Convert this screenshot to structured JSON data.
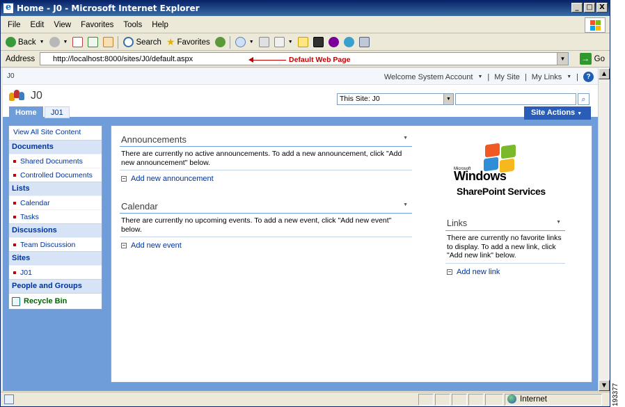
{
  "window": {
    "title": "Home - J0 - Microsoft Internet Explorer",
    "controls": [
      "_",
      "□",
      "X"
    ]
  },
  "menu": [
    "File",
    "Edit",
    "View",
    "Favorites",
    "Tools",
    "Help"
  ],
  "toolbar": {
    "back": "Back",
    "search": "Search",
    "favorites": "Favorites"
  },
  "address": {
    "label": "Address",
    "url": "http://localhost:8000/sites/J0/default.aspx",
    "go": "Go",
    "annotation": "Default Web Page"
  },
  "sharepoint": {
    "breadcrumb": "J0",
    "welcome": "Welcome System Account",
    "my_site": "My Site",
    "my_links": "My Links",
    "site_name": "J0",
    "search_scope": "This Site: J0",
    "tabs": [
      "Home",
      "J01"
    ],
    "site_actions": "Site Actions"
  },
  "leftnav": {
    "view_all": "View All Site Content",
    "sections": [
      {
        "heading": "Documents",
        "items": [
          "Shared Documents",
          "Controlled Documents"
        ]
      },
      {
        "heading": "Lists",
        "items": [
          "Calendar",
          "Tasks"
        ]
      },
      {
        "heading": "Discussions",
        "items": [
          "Team Discussion"
        ]
      },
      {
        "heading": "Sites",
        "items": [
          "J01"
        ]
      },
      {
        "heading": "People and Groups",
        "items": []
      }
    ],
    "recycle_bin": "Recycle Bin"
  },
  "announcements": {
    "title": "Announcements",
    "body": "There are currently no active announcements. To add a new announcement, click \"Add new announcement\" below.",
    "link": "Add new announcement"
  },
  "calendar": {
    "title": "Calendar",
    "body": "There are currently no upcoming events. To add a new event, click \"Add new event\" below.",
    "link": "Add new event"
  },
  "wss_logo": {
    "microsoft": "Microsoft",
    "windows": "Windows",
    "sharepoint": "SharePoint Services"
  },
  "links": {
    "title": "Links",
    "body": "There are currently no favorite links to display. To add a new link, click \"Add new link\" below.",
    "link": "Add new link"
  },
  "status": {
    "zone": "Internet"
  },
  "figure_id": "193377"
}
